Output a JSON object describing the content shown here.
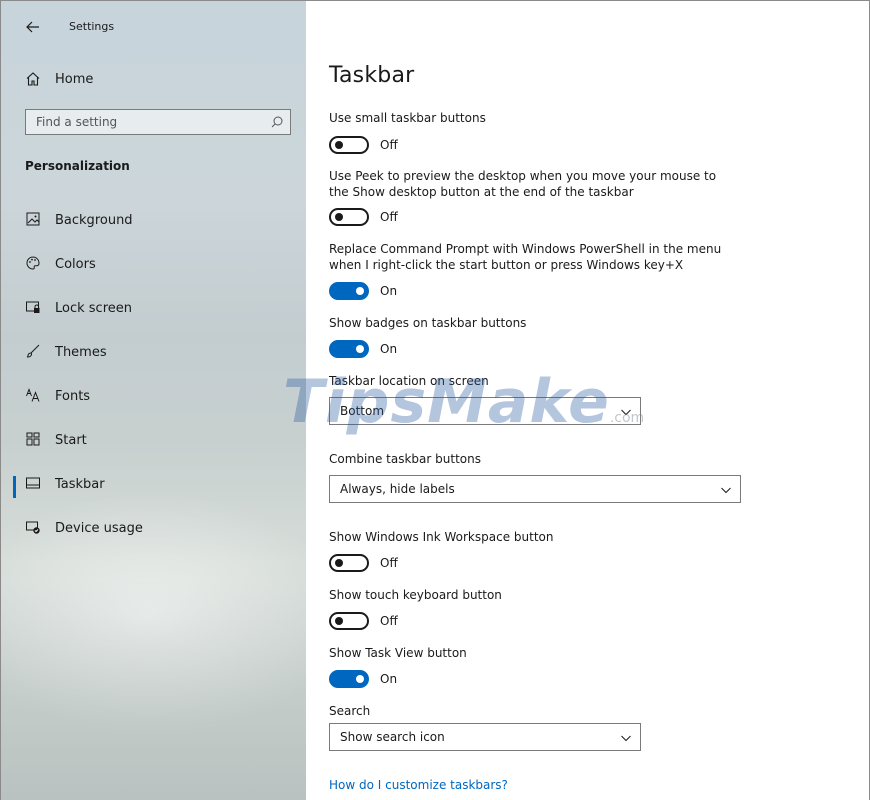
{
  "window": {
    "title": "Settings"
  },
  "sidebar": {
    "home_label": "Home",
    "search_placeholder": "Find a setting",
    "section_header": "Personalization",
    "items": [
      {
        "label": "Background",
        "icon": "image-icon",
        "active": false
      },
      {
        "label": "Colors",
        "icon": "palette-icon",
        "active": false
      },
      {
        "label": "Lock screen",
        "icon": "lock-screen-icon",
        "active": false
      },
      {
        "label": "Themes",
        "icon": "brush-icon",
        "active": false
      },
      {
        "label": "Fonts",
        "icon": "font-icon",
        "active": false
      },
      {
        "label": "Start",
        "icon": "start-grid-icon",
        "active": false
      },
      {
        "label": "Taskbar",
        "icon": "taskbar-icon",
        "active": true
      },
      {
        "label": "Device usage",
        "icon": "device-usage-icon",
        "active": false
      }
    ]
  },
  "main": {
    "title": "Taskbar",
    "settings": {
      "small_buttons": {
        "label": "Use small taskbar buttons",
        "state": "Off"
      },
      "peek": {
        "label": "Use Peek to preview the desktop when you move your mouse to the Show desktop button at the end of the taskbar",
        "state": "Off"
      },
      "powershell": {
        "label": "Replace Command Prompt with Windows PowerShell in the menu when I right-click the start button or press Windows key+X",
        "state": "On"
      },
      "badges": {
        "label": "Show badges on taskbar buttons",
        "state": "On"
      },
      "location": {
        "label": "Taskbar location on screen",
        "value": "Bottom"
      },
      "combine": {
        "label": "Combine taskbar buttons",
        "value": "Always, hide labels"
      },
      "ink": {
        "label": "Show Windows Ink Workspace button",
        "state": "Off"
      },
      "touch_keyboard": {
        "label": "Show touch keyboard button",
        "state": "Off"
      },
      "task_view": {
        "label": "Show Task View button",
        "state": "On"
      },
      "search": {
        "label": "Search",
        "value": "Show search icon"
      }
    },
    "help_link": "How do I customize taskbars?"
  },
  "watermark": {
    "main": "TipsMake",
    "suffix": ".com"
  },
  "colors": {
    "accent": "#0067c0",
    "text": "#1a1a1a"
  }
}
